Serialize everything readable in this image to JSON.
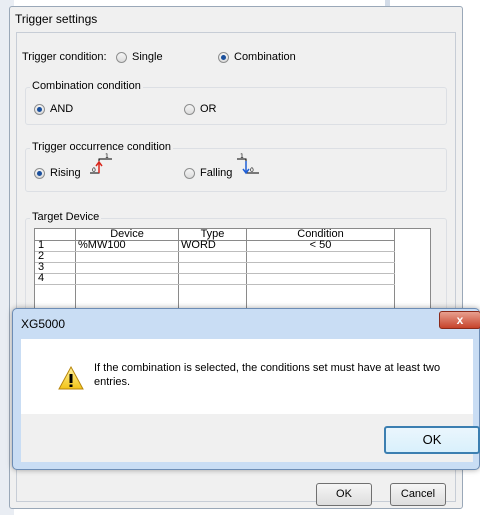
{
  "trigger": {
    "title": "Trigger settings",
    "condition_label": "Trigger condition:",
    "single_label": "Single",
    "combination_label": "Combination",
    "combination_group": {
      "title": "Combination condition",
      "and_label": "AND",
      "or_label": "OR"
    },
    "occurrence_group": {
      "title": "Trigger occurrence condition",
      "rising_label": "Rising",
      "falling_label": "Falling"
    },
    "target_group": {
      "title": "Target Device",
      "columns": [
        "Device",
        "Type",
        "Condition"
      ],
      "rows": [
        {
          "num": "1",
          "device": "%MW100",
          "type": "WORD",
          "condition": "< 50"
        },
        {
          "num": "2",
          "device": "",
          "type": "",
          "condition": ""
        },
        {
          "num": "3",
          "device": "",
          "type": "",
          "condition": ""
        },
        {
          "num": "4",
          "device": "",
          "type": "",
          "condition": ""
        }
      ]
    },
    "ok_label": "OK",
    "cancel_label": "Cancel"
  },
  "dialog": {
    "title": "XG5000",
    "close_glyph": "x",
    "message": "If the combination is selected, the conditions set must have at least two entries.",
    "ok_label": "OK"
  },
  "icons": {
    "warning": "warning-icon",
    "rising_edge": "rising-edge-icon",
    "falling_edge": "falling-edge-icon"
  },
  "colors": {
    "selected_radio": "#1a4f9c",
    "close_button": "#c7432b",
    "rising_edge": "#d9261c",
    "falling_edge": "#1f5fd6"
  }
}
